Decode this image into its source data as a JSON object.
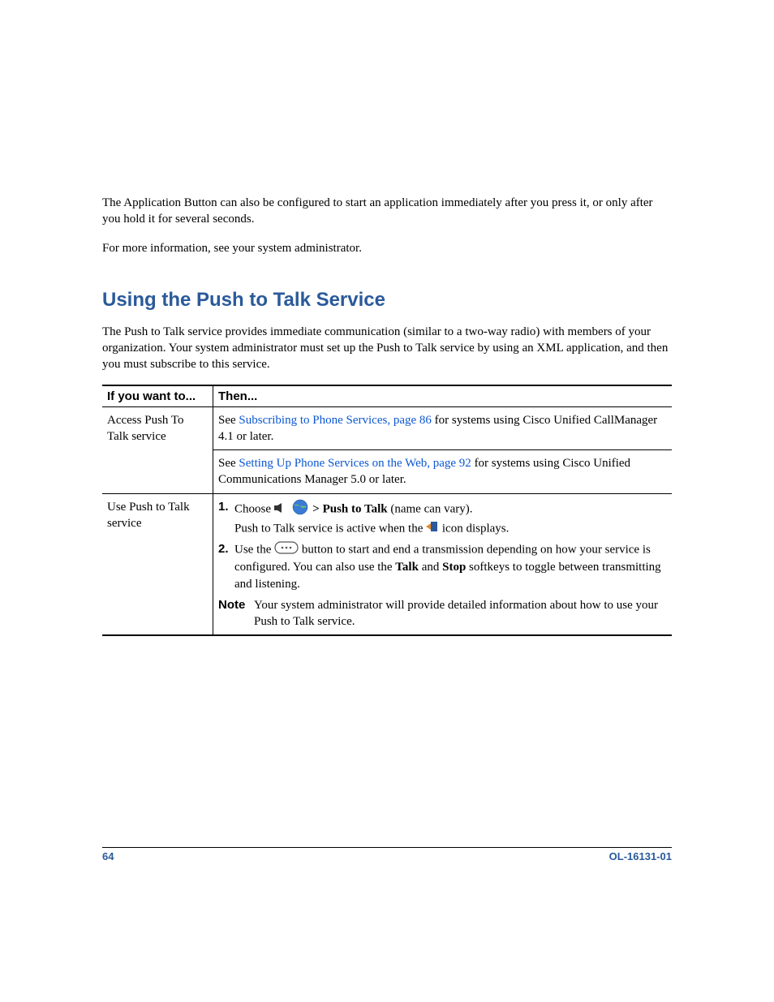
{
  "intro": {
    "para1": "The Application Button can also be configured to start an application immediately after you press it, or only after you hold it for several seconds.",
    "para2": "For more information, see your system administrator."
  },
  "section": {
    "heading": "Using the Push to Talk Service",
    "intro": "The Push to Talk service provides immediate communication (similar to a two-way radio) with members of your organization. Your system administrator must set up the Push to Talk service by using an XML application, and then you must subscribe to this service."
  },
  "table": {
    "headers": {
      "col1": "If you want to...",
      "col2": "Then..."
    },
    "row1": {
      "left": "Access Push To Talk service",
      "cell1": {
        "pre": "See ",
        "link": "Subscribing to Phone Services, page 86",
        "post": " for systems using Cisco Unified CallManager 4.1 or later."
      },
      "cell2": {
        "pre": "See ",
        "link": "Setting Up Phone Services on the Web, page 92",
        "post": " for systems using Cisco Unified Communications Manager 5.0 or later."
      }
    },
    "row2": {
      "left": "Use Push to Talk service",
      "step1": {
        "num": "1.",
        "choose": "Choose ",
        "arrow": " > ",
        "bold": "Push to Talk",
        "tail": " (name can vary).",
        "line2a": "Push to Talk service is active when the ",
        "line2b": " icon displays."
      },
      "step2": {
        "num": "2.",
        "pre": "Use the ",
        "mid": " button to start and end a transmission depending on how your service is configured. You can also use the ",
        "talk": "Talk",
        "and": " and ",
        "stop": "Stop",
        "post": " softkeys to toggle between transmitting and listening."
      },
      "note": {
        "label": "Note",
        "text": "Your system administrator will provide detailed information about how to use your Push to Talk service."
      }
    }
  },
  "footer": {
    "page": "64",
    "doc": "OL-16131-01"
  }
}
